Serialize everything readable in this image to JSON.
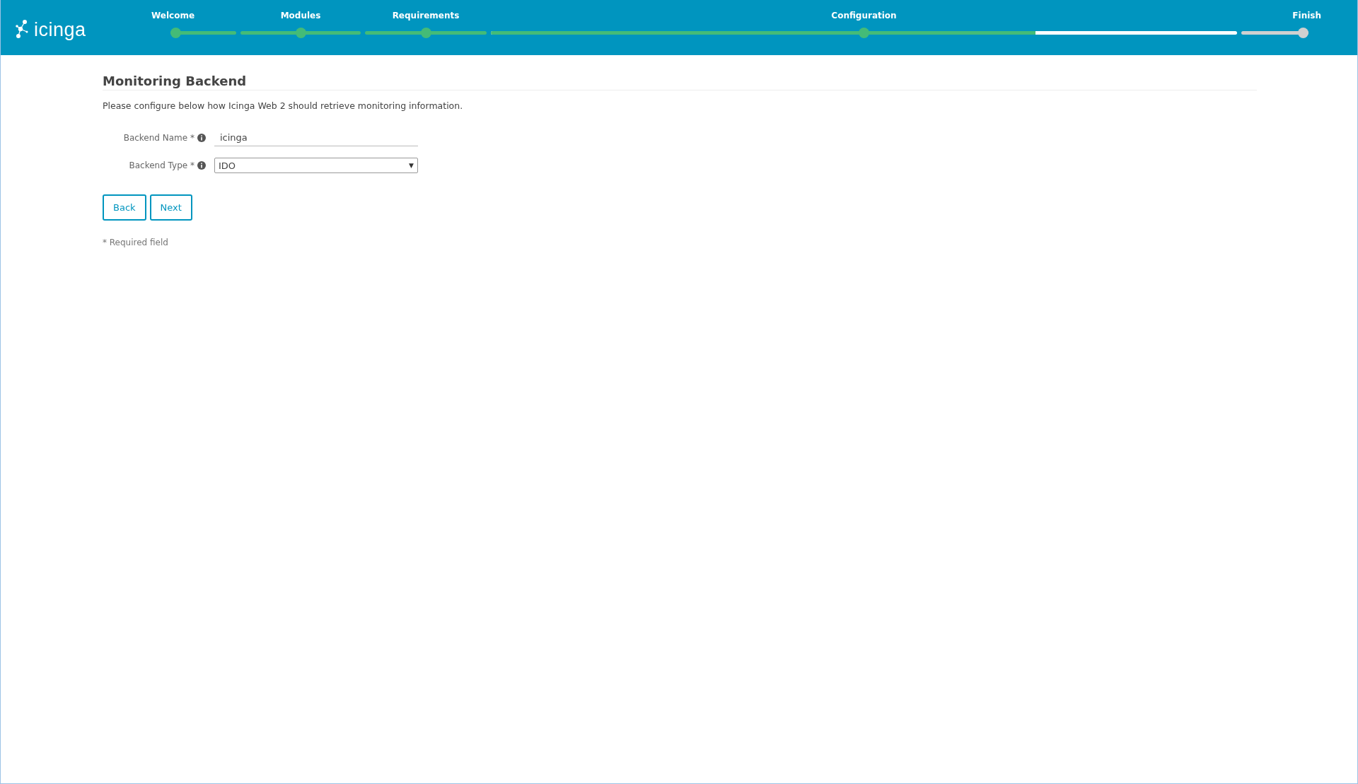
{
  "logo": {
    "text": "icinga"
  },
  "steps": [
    {
      "label": "Welcome",
      "reached": true
    },
    {
      "label": "Modules",
      "reached": true
    },
    {
      "label": "Requirements",
      "reached": true
    },
    {
      "label": "Configuration",
      "reached": true,
      "level": 0.73
    },
    {
      "label": "Finish",
      "reached": false
    }
  ],
  "title": "Monitoring Backend",
  "description": "Please configure below how Icinga Web 2 should retrieve monitoring information.",
  "fields": [
    {
      "kind": "text",
      "label": "Backend Name *",
      "value": "icinga"
    },
    {
      "kind": "select",
      "label": "Backend Type *",
      "value": "IDO",
      "caret": "▼"
    }
  ],
  "buttons": [
    "Back",
    "Next"
  ],
  "note": "* Required field"
}
